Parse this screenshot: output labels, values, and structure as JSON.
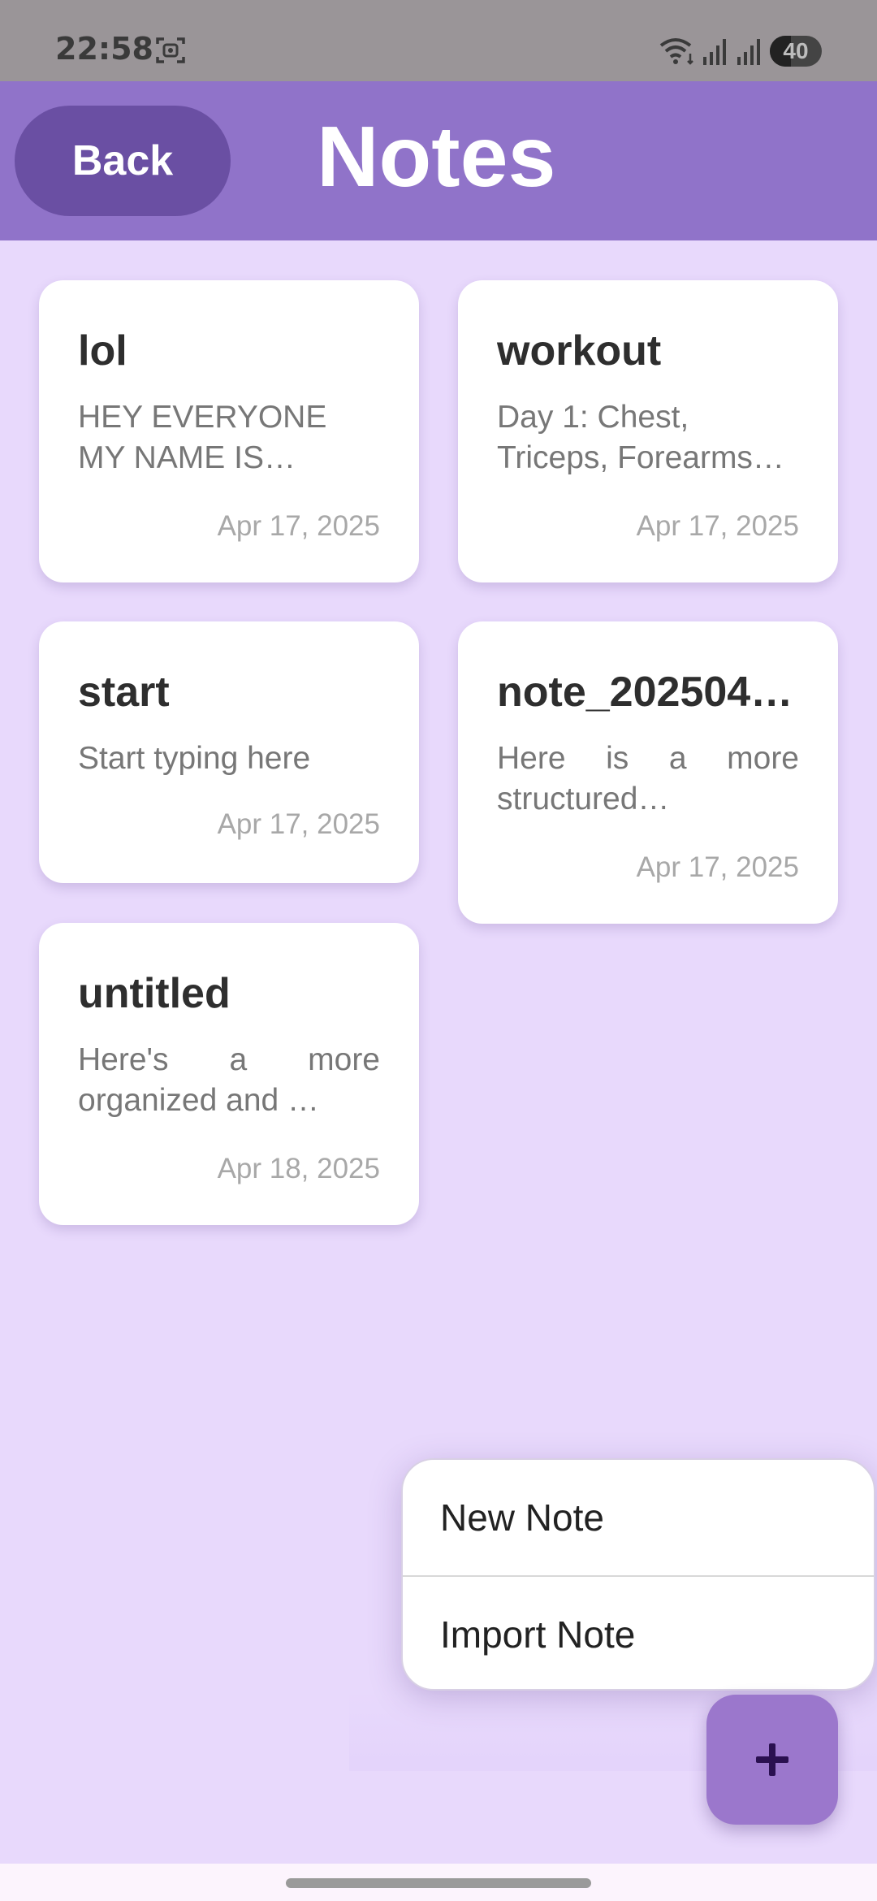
{
  "status_bar": {
    "time": "22:58",
    "battery_level": "40",
    "icons": [
      "screenshot-icon",
      "wifi-icon",
      "signal-icon",
      "signal-icon",
      "battery-icon"
    ]
  },
  "app_bar": {
    "back_label": "Back",
    "title": "Notes"
  },
  "notes": [
    {
      "title": "lol",
      "preview": "HEY EVERYONE MY NAME IS SAMYAK…",
      "date": "Apr 17, 2025"
    },
    {
      "title": "workout",
      "preview": "Day 1: Chest, Triceps, Forearms…",
      "date": "Apr 17, 2025"
    },
    {
      "title": "start",
      "preview": "Start typing here",
      "date": "Apr 17, 2025"
    },
    {
      "title": "note_202504…",
      "preview": "Here is a more structured…",
      "date": "Apr 17, 2025"
    },
    {
      "title": "untitled",
      "preview": "Here's a more organized and …",
      "date": "Apr 18, 2025"
    }
  ],
  "menu": {
    "items": [
      {
        "label": "New Note"
      },
      {
        "label": "Import Note"
      }
    ]
  },
  "fab": {
    "icon": "plus-icon"
  },
  "colors": {
    "background": "#e8d9fc",
    "app_bar": "#9073c9",
    "back_button": "#6a4fa3",
    "fab": "#9b77cc",
    "card": "#ffffff"
  }
}
